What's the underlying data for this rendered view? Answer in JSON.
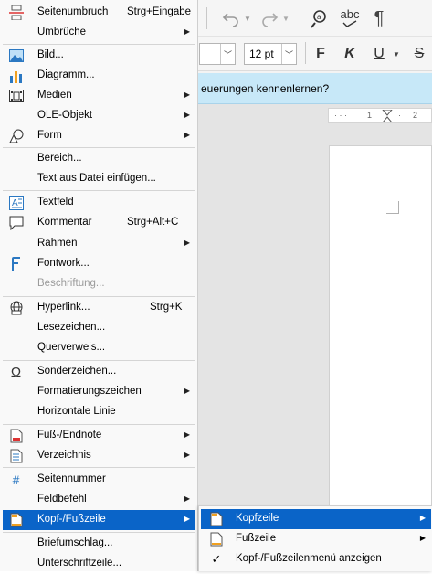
{
  "toolbar": {
    "font_size_value": "12 pt",
    "spelling_label": "abc",
    "bold_label": "F",
    "italic_label": "K",
    "underline_label": "U"
  },
  "infobar": {
    "message": "euerungen kennenlernen?"
  },
  "ruler": {
    "marks": [
      "1",
      "2"
    ]
  },
  "menu": {
    "items": [
      {
        "label": "Seitenumbruch",
        "shortcut": "Strg+Eingabe"
      },
      {
        "label": "Umbrüche"
      },
      {
        "label": "Bild..."
      },
      {
        "label": "Diagramm..."
      },
      {
        "label": "Medien"
      },
      {
        "label": "OLE-Objekt"
      },
      {
        "label": "Form"
      },
      {
        "label": "Bereich..."
      },
      {
        "label": "Text aus Datei einfügen..."
      },
      {
        "label": "Textfeld"
      },
      {
        "label": "Kommentar",
        "shortcut": "Strg+Alt+C"
      },
      {
        "label": "Rahmen"
      },
      {
        "label": "Fontwork..."
      },
      {
        "label": "Beschriftung..."
      },
      {
        "label": "Hyperlink...",
        "shortcut": "Strg+K"
      },
      {
        "label": "Lesezeichen..."
      },
      {
        "label": "Querverweis..."
      },
      {
        "label": "Sonderzeichen..."
      },
      {
        "label": "Formatierungszeichen"
      },
      {
        "label": "Horizontale Linie"
      },
      {
        "label": "Fuß-/Endnote"
      },
      {
        "label": "Verzeichnis"
      },
      {
        "label": "Seitennummer"
      },
      {
        "label": "Feldbefehl"
      },
      {
        "label": "Kopf-/Fußzeile"
      },
      {
        "label": "Briefumschlag..."
      },
      {
        "label": "Unterschriftzeile..."
      }
    ]
  },
  "submenu": {
    "items": [
      {
        "label": "Kopfzeile"
      },
      {
        "label": "Fußzeile"
      },
      {
        "label": "Kopf-/Fußzeilenmenü anzeigen"
      }
    ]
  },
  "colors": {
    "highlight": "#0a64c8",
    "infobar": "#c7e8f8",
    "menu_bg": "#f9f9f9"
  }
}
